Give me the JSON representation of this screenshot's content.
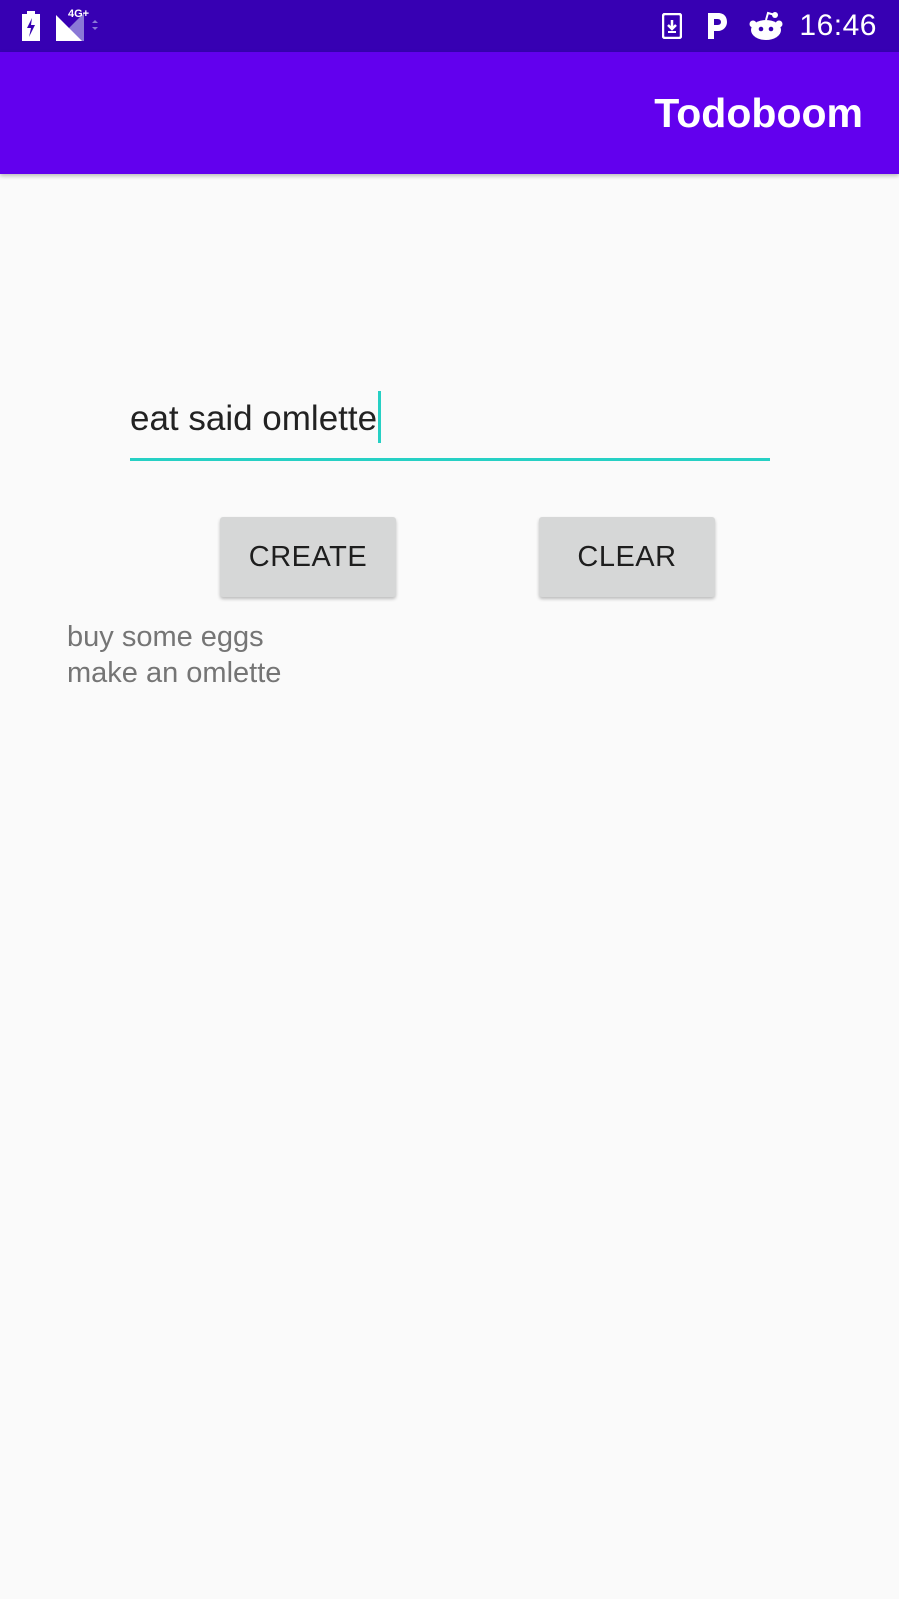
{
  "status_bar": {
    "time": "16:46",
    "network_label": "4G+",
    "icons": [
      "battery-charging-icon",
      "signal-icon",
      "download-notification-icon",
      "p-app-icon",
      "reddit-icon"
    ]
  },
  "app_bar": {
    "title": "Todoboom"
  },
  "todo_input": {
    "value": "eat said omlette"
  },
  "buttons": {
    "create_label": "CREATE",
    "clear_label": "CLEAR"
  },
  "todos": [
    "buy some eggs",
    "make an omlette"
  ],
  "colors": {
    "status_bar": "#3700b3",
    "app_bar": "#6200ee",
    "accent": "#26d0c4",
    "button": "#d6d7d7",
    "list_text": "#757575"
  }
}
